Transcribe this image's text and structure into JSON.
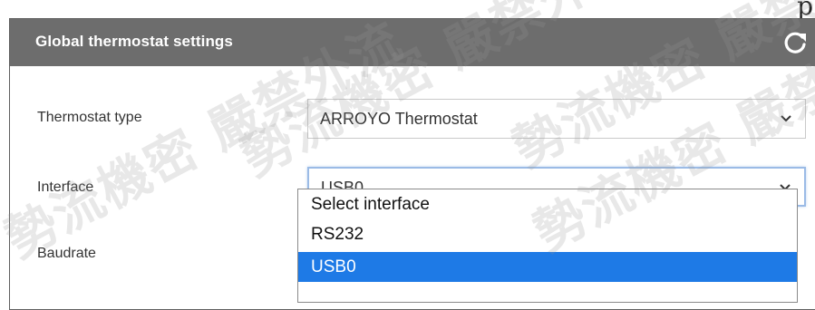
{
  "header": {
    "title": "Global thermostat settings",
    "refresh_icon": "refresh-icon"
  },
  "fields": [
    {
      "label": "Thermostat type",
      "value": "ARROYO Thermostat"
    },
    {
      "label": "Interface",
      "value": "USB0"
    },
    {
      "label": "Baudrate"
    }
  ],
  "interface_dropdown": {
    "options": [
      "Select interface",
      "RS232",
      "USB0"
    ],
    "selected": "USB0"
  },
  "watermark_text": [
    "勢流機密 嚴禁外流",
    "勢流機密 嚴禁外流",
    "勢流機密 嚴禁",
    "勢流機密 嚴禁外流"
  ],
  "colors": {
    "header_bg": "#6d6d6d",
    "selected_option_bg": "#1e7ae6",
    "focus_border": "#9bbbe6"
  }
}
